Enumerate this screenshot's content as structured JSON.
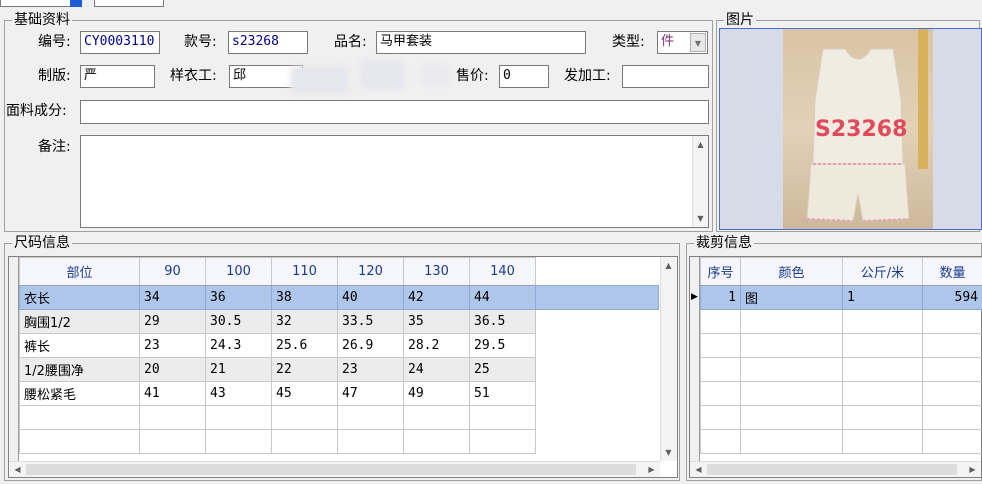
{
  "top": {
    "tab_label": ""
  },
  "basic": {
    "title": "基础资料",
    "code_label": "编号:",
    "code_value": "CY0003110",
    "style_label": "款号:",
    "style_value": "s23268",
    "name_label": "品名:",
    "name_value": "马甲套装",
    "type_label": "类型:",
    "type_value": "件",
    "pattern_label": "制版:",
    "pattern_value": "严",
    "sample_label": "样衣工:",
    "sample_value": "邱",
    "price_label": "售价:",
    "price_value": "0",
    "outwork_label": "发加工:",
    "outwork_value": "",
    "fabric_label": "面料成分:",
    "fabric_value": "",
    "notes_label": "备注:",
    "notes_value": ""
  },
  "picture": {
    "title": "图片",
    "photo_text": "S23268"
  },
  "sizes": {
    "title": "尺码信息",
    "headers": [
      "部位",
      "90",
      "100",
      "110",
      "120",
      "130",
      "140"
    ],
    "rows": [
      [
        "衣长",
        "34",
        "36",
        "38",
        "40",
        "42",
        "44"
      ],
      [
        "胸围1/2",
        "29",
        "30.5",
        "32",
        "33.5",
        "35",
        "36.5"
      ],
      [
        "裤长",
        "23",
        "24.3",
        "25.6",
        "26.9",
        "28.2",
        "29.5"
      ],
      [
        "1/2腰围净",
        "20",
        "21",
        "22",
        "23",
        "24",
        "25"
      ],
      [
        "腰松紧毛",
        "41",
        "43",
        "45",
        "47",
        "49",
        "51"
      ]
    ]
  },
  "cutting": {
    "title": "裁剪信息",
    "headers": [
      "序号",
      "颜色",
      "公斤/米",
      "数量"
    ],
    "rows": [
      [
        "1",
        "图",
        "1",
        "594"
      ]
    ]
  },
  "colors": {
    "selected_row": "#aec6ea",
    "header_text": "#1b3a8c",
    "field_text": "#00008b"
  }
}
